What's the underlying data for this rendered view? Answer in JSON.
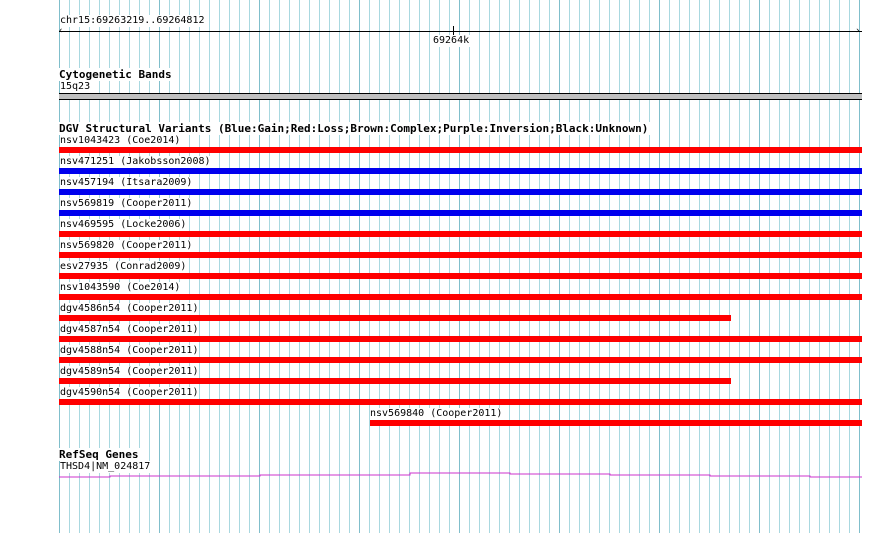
{
  "ruler": {
    "locus": "chr15:69263219..69264812",
    "center_label": "69264k"
  },
  "cytoband": {
    "title": "Cytogenetic Bands",
    "band": "15q23",
    "band_color": "#c0c0c0"
  },
  "dgv": {
    "title": "DGV Structural Variants (Blue:Gain;Red:Loss;Brown:Complex;Purple:Inversion;Black:Unknown)",
    "colors": {
      "loss": "#ff0000",
      "gain": "#0000ee"
    },
    "variants": [
      {
        "label": "nsv1043423 (Coe2014)",
        "type": "loss",
        "extent": "full"
      },
      {
        "label": "nsv471251 (Jakobsson2008)",
        "type": "gain",
        "extent": "full"
      },
      {
        "label": "nsv457194 (Itsara2009)",
        "type": "gain",
        "extent": "full"
      },
      {
        "label": "nsv569819 (Cooper2011)",
        "type": "gain",
        "extent": "full"
      },
      {
        "label": "nsv469595 (Locke2006)",
        "type": "loss",
        "extent": "full"
      },
      {
        "label": "nsv569820 (Cooper2011)",
        "type": "loss",
        "extent": "full"
      },
      {
        "label": "esv27935 (Conrad2009)",
        "type": "loss",
        "extent": "full"
      },
      {
        "label": "nsv1043590 (Coe2014)",
        "type": "loss",
        "extent": "full"
      },
      {
        "label": "dgv4586n54 (Cooper2011)",
        "type": "loss",
        "extent": "ends-before-right"
      },
      {
        "label": "dgv4587n54 (Cooper2011)",
        "type": "loss",
        "extent": "full"
      },
      {
        "label": "dgv4588n54 (Cooper2011)",
        "type": "loss",
        "extent": "full"
      },
      {
        "label": "dgv4589n54 (Cooper2011)",
        "type": "loss",
        "extent": "ends-before-right"
      },
      {
        "label": "dgv4590n54 (Cooper2011)",
        "type": "loss",
        "extent": "full"
      },
      {
        "label": "nsv569840 (Cooper2011)",
        "type": "loss",
        "extent": "starts-mid"
      }
    ]
  },
  "refseq": {
    "title": "RefSeq Genes",
    "gene_label": "THSD4|NM_024817",
    "gene_color": "#cc33cc"
  }
}
